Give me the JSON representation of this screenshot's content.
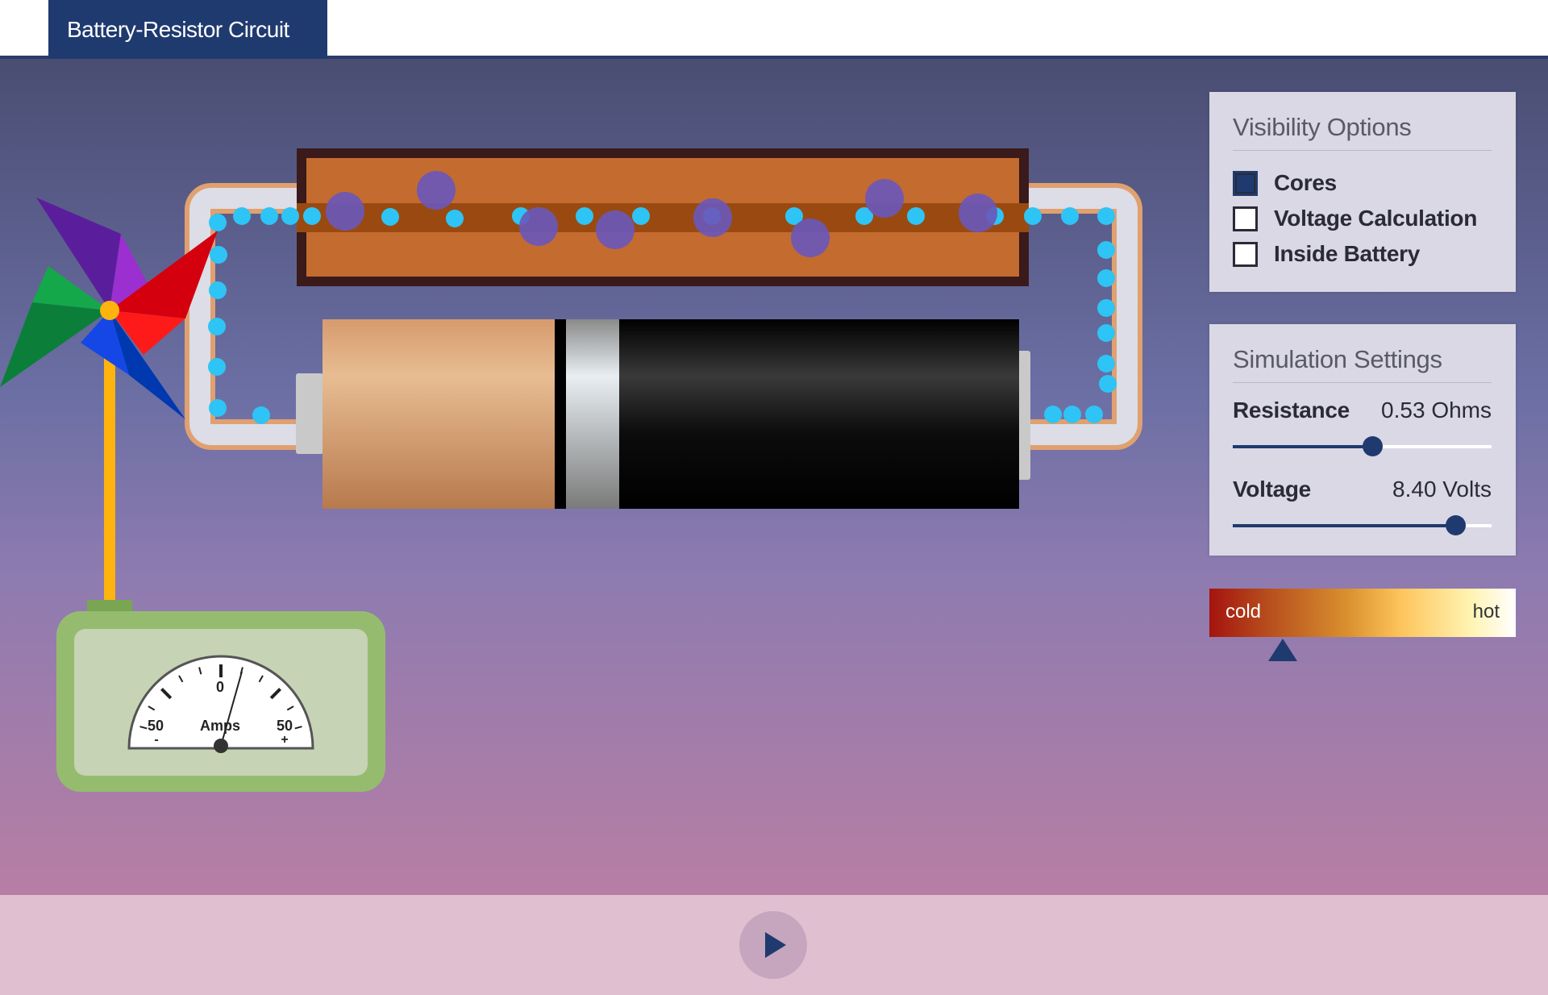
{
  "tab": {
    "title": "Battery-Resistor Circuit"
  },
  "visibility_panel": {
    "title": "Visibility Options",
    "options": [
      {
        "label": "Cores",
        "checked": true
      },
      {
        "label": "Voltage Calculation",
        "checked": false
      },
      {
        "label": "Inside Battery",
        "checked": false
      }
    ]
  },
  "simulation_panel": {
    "title": "Simulation Settings",
    "resistance": {
      "label": "Resistance",
      "value_text": "0.53 Ohms",
      "fraction": 0.54
    },
    "voltage": {
      "label": "Voltage",
      "value_text": "8.40 Volts",
      "fraction": 0.86
    }
  },
  "heat_indicator": {
    "cold_label": "cold",
    "hot_label": "hot",
    "level": 0.24
  },
  "ammeter": {
    "zero_label": "0",
    "left_label": "50",
    "right_label": "50",
    "minus": "-",
    "plus": "+",
    "unit_label": "Amps"
  },
  "colors": {
    "accent": "#1f3a6e",
    "electron": "#2ec4f5",
    "core": "#6a58b8",
    "resistor": "#c46b30",
    "wire_border": "#e0a070"
  },
  "icons": {
    "play": "play-icon",
    "pinwheel": "pinwheel-icon"
  }
}
